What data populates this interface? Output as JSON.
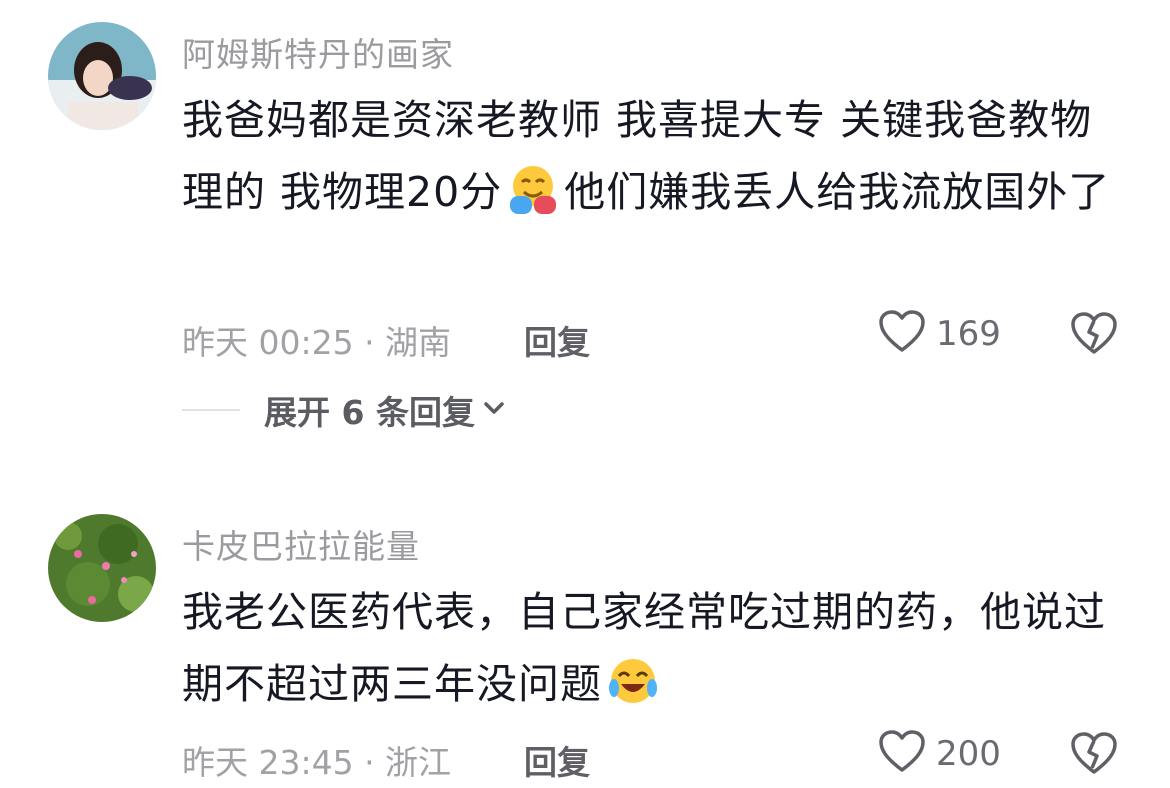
{
  "comments": [
    {
      "username": "阿姆斯特丹的画家",
      "text_before_emoji": "我爸妈都是资深老教师 我喜提大专 关键我爸教物理的 我物理20分",
      "emoji": "hugging-face-emoji",
      "text_after_emoji": "他们嫌我丢人给我流放国外了",
      "meta": "昨天 00:25 · 湖南",
      "reply_label": "回复",
      "likes": "169"
    },
    {
      "username": "卡皮巴拉拉能量",
      "text_before_emoji": "我老公医药代表，自己家经常吃过期的药，他说过期不超过两三年没问题",
      "emoji": "crying-laughing-emoji",
      "text_after_emoji": "",
      "meta": "昨天 23:45 · 浙江",
      "reply_label": "回复",
      "likes": "200"
    }
  ],
  "expand_replies": "展开 6 条回复",
  "colors": {
    "username": "#9a9a9f",
    "text": "#161823",
    "meta": "#a1a1a6",
    "reply": "#5f5f66"
  }
}
